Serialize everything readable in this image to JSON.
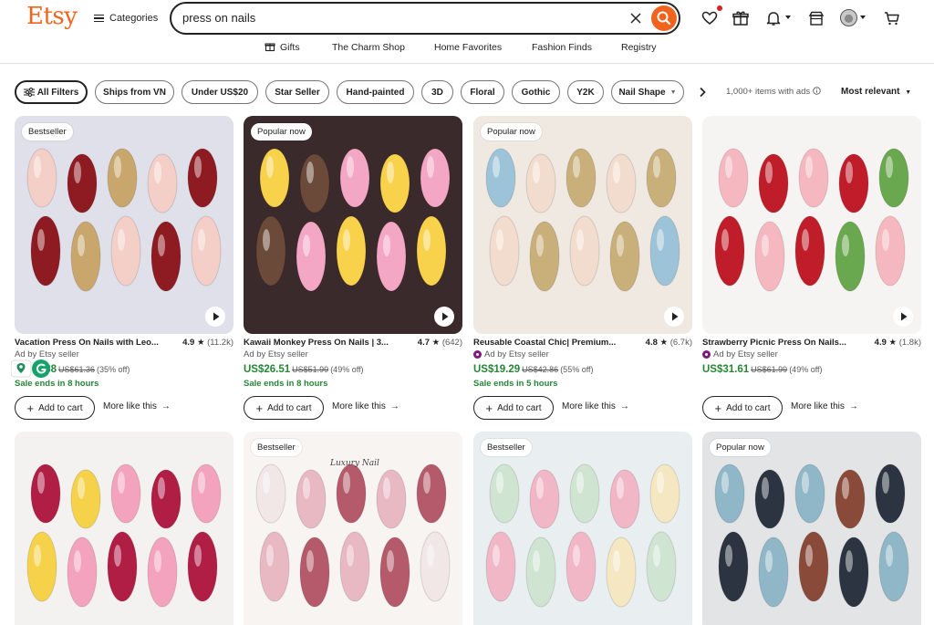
{
  "header": {
    "logo": "Etsy",
    "categories_label": "Categories",
    "search_value": "press on nails"
  },
  "subnav": [
    "Gifts",
    "The Charm Shop",
    "Home Favorites",
    "Fashion Finds",
    "Registry"
  ],
  "filters": {
    "chips": [
      "All Filters",
      "Ships from VN",
      "Under US$20",
      "Star Seller",
      "Hand-painted",
      "3D",
      "Floral",
      "Gothic",
      "Y2K",
      "Nail Shape"
    ],
    "results_text": "1,000+ items with ads",
    "sort_label": "Most relevant"
  },
  "products": [
    {
      "badge": "Bestseller",
      "title": "Vacation Press On Nails with Leo...",
      "rating": "4.9",
      "reviews": "(11.2k)",
      "seller": "Ad by Etsy seller",
      "price": "US$24.88",
      "price_visible": ".88",
      "was": "US$61.36",
      "off": "(35% off)",
      "sale": "Sale ends in 8 hours",
      "star_seller": false,
      "palette": [
        "#dfe0ea",
        "#f3cfc7",
        "#8e1a22",
        "#c9a66b"
      ]
    },
    {
      "badge": "Popular now",
      "title": "Kawaii Monkey Press On Nails | 3...",
      "rating": "4.7",
      "reviews": "(642)",
      "seller": "Ad by Etsy seller",
      "price": "US$26.51",
      "was": "US$51.99",
      "off": "(49% off)",
      "sale": "Sale ends in 8 hours",
      "star_seller": false,
      "palette": [
        "#3a2a2c",
        "#f4a7c4",
        "#f7d24a",
        "#6b4a3a"
      ]
    },
    {
      "badge": "Popular now",
      "title": "Reusable Coastal Chic| Premium...",
      "rating": "4.8",
      "reviews": "(6.7k)",
      "seller": "Ad by Etsy seller",
      "price": "US$19.29",
      "was": "US$42.86",
      "off": "(55% off)",
      "sale": "Sale ends in 5 hours",
      "star_seller": true,
      "palette": [
        "#efe9e2",
        "#f2dccd",
        "#c9b07a",
        "#9cc3d8"
      ]
    },
    {
      "badge": "",
      "title": "Strawberry Picnic Press On Nails...",
      "rating": "4.9",
      "reviews": "(1.8k)",
      "seller": "Ad by Etsy seller",
      "price": "US$31.61",
      "was": "US$61.99",
      "off": "(49% off)",
      "sale": "",
      "star_seller": true,
      "palette": [
        "#f6f4f2",
        "#f5b8c0",
        "#c01d2a",
        "#6aa84f"
      ]
    }
  ],
  "row2": [
    {
      "badge": "",
      "palette": [
        "#f3f2f0",
        "#f4a3bf",
        "#b01d45",
        "#f5d24a"
      ]
    },
    {
      "badge": "Bestseller",
      "brand": "Luxury Nail",
      "palette": [
        "#f7f4f2",
        "#e8b9c3",
        "#b45a6a",
        "#f1e7e7"
      ]
    },
    {
      "badge": "Bestseller",
      "palette": [
        "#e9eef0",
        "#cfe5d2",
        "#f1b7c7",
        "#f5e7c2"
      ]
    },
    {
      "badge": "Popular now",
      "palette": [
        "#e3e4e6",
        "#2b3440",
        "#8fb7c7",
        "#8a4a3a"
      ]
    }
  ],
  "card_actions": {
    "add_to_cart": "Add to cart",
    "more_like_this": "More like this"
  },
  "colors": {
    "brand": "#f1641e",
    "sale_green": "#258635",
    "star_seller": "#7f187f"
  }
}
